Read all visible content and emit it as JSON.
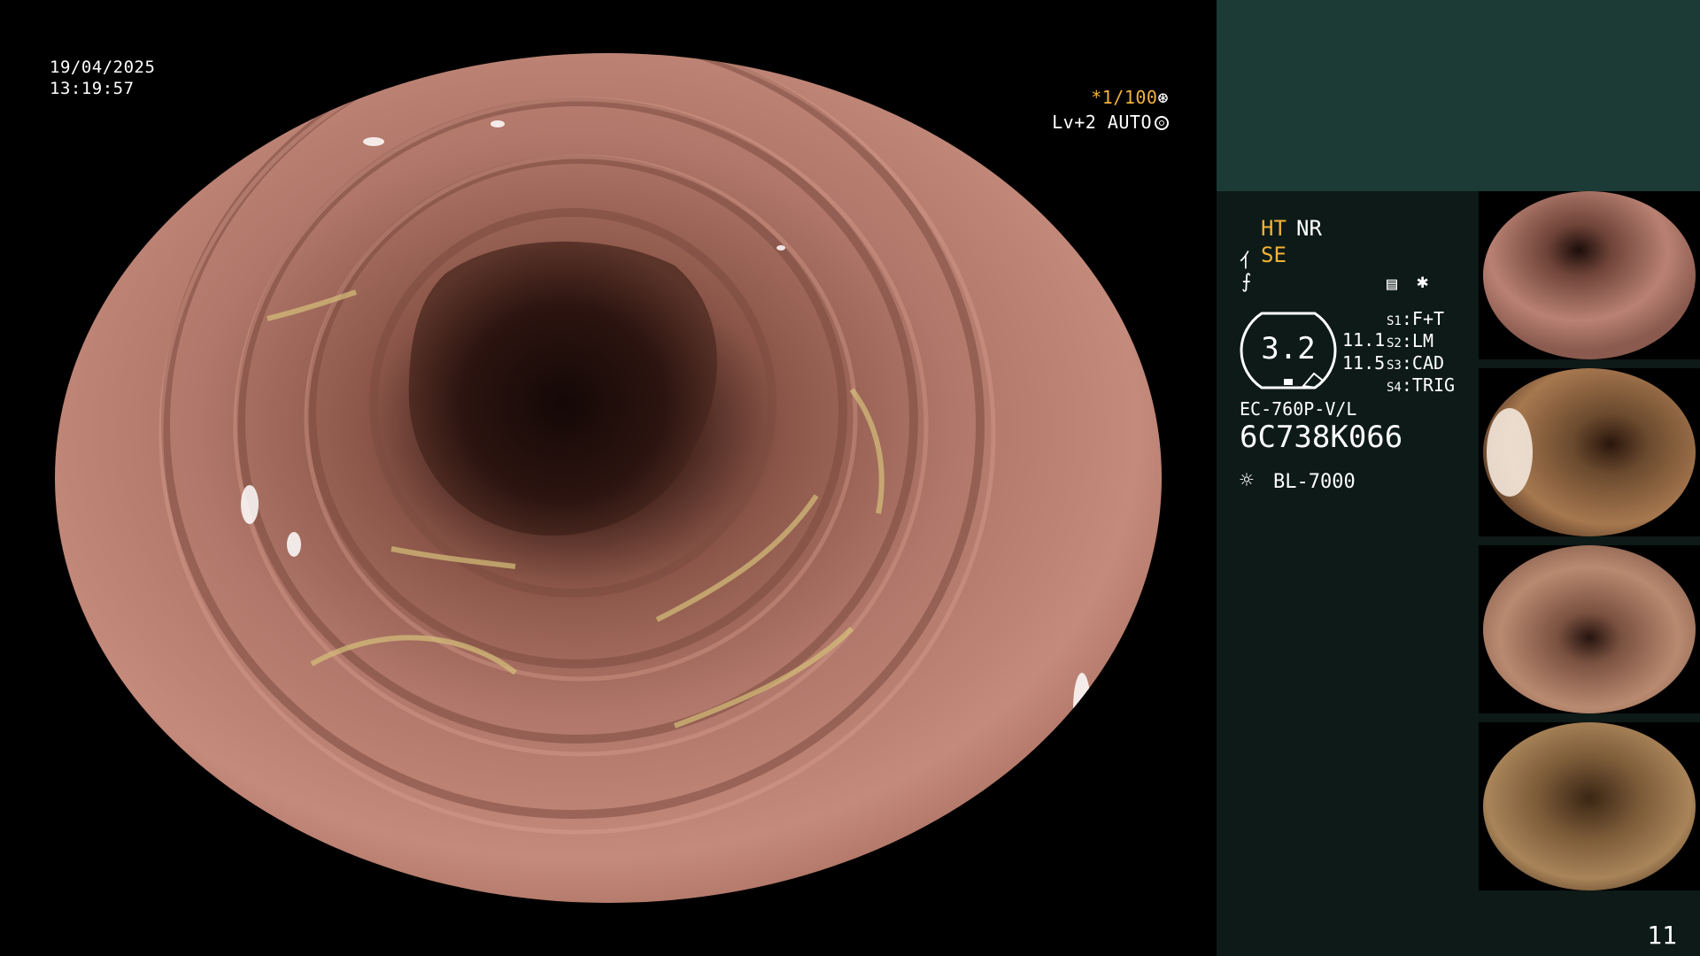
{
  "overlay": {
    "date": "19/04/2025",
    "time": "13:19:57",
    "shutter": "*1/100",
    "iris": "Lv+2 AUTO"
  },
  "panel": {
    "ht": "HT",
    "nr": "NR",
    "se": "SE",
    "scope_value": "3.2",
    "value_a": "11.1",
    "value_b": "11.5",
    "switches": [
      {
        "key": "S1",
        "label": "F+T"
      },
      {
        "key": "S2",
        "label": "LM"
      },
      {
        "key": "S3",
        "label": "CAD"
      },
      {
        "key": "S4",
        "label": "TRIG"
      }
    ],
    "scope_model": "EC-760P-V/L",
    "serial": "6C738K066",
    "light_source": "BL-7000",
    "page_number": "11"
  },
  "colors": {
    "accent": "#f2b135",
    "panel_bg": "#0d1a17",
    "panel_header": "#1c3b36",
    "mucosa": "#b5796c"
  },
  "icons": [
    "settings-dial-icon",
    "auto-iris-icon",
    "enhancement-icon",
    "structure-icon",
    "document-icon",
    "light-source-icon"
  ]
}
